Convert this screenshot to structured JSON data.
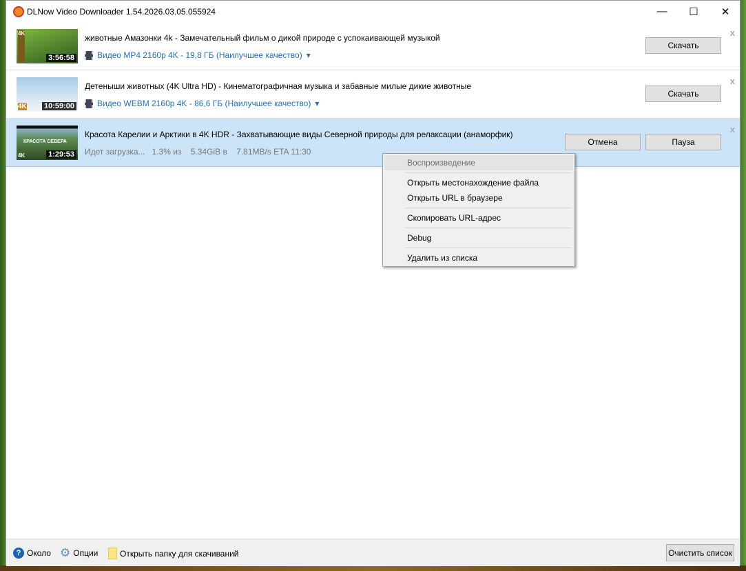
{
  "window": {
    "title": "DLNow Video Downloader 1.54.2026.03.05.055924",
    "minimize": "—",
    "maximize": "☐",
    "close": "✕"
  },
  "items": [
    {
      "title": "животные Амазонки 4k - Замечательный фильм о дикой природе с успокаивающей музыкой",
      "duration": "3:56:58",
      "badge": "4K",
      "format": "Видео MP4 2160p 4K - 19,8 ГБ (Наилучшее качество)",
      "button": "Скачать",
      "remove": "x",
      "thumb_colors": [
        "#6ea83a",
        "#2f5a1a"
      ]
    },
    {
      "title": "Детеныши животных (4K Ultra HD) - Кинематографичная музыка и забавные милые дикие животные",
      "duration": "10:59:00",
      "badge": "4K",
      "format": "Видео WEBM 2160p 4K - 86,6 ГБ (Наилучшее качество)",
      "button": "Скачать",
      "remove": "x",
      "thumb_colors": [
        "#bcd8ee",
        "#f4f6f8"
      ]
    },
    {
      "title": "Красота Карелии и Арктики в 4K HDR - Захватывающие виды Северной природы для релаксации (анаморфик)",
      "duration": "1:29:53",
      "badge": "4K",
      "thumb_text": "КРАСОТА СЕВЕРА",
      "status": "Идет загрузка...   1.3% из    5.34GiB в    7.81MB/s ETA 11:30",
      "cancel": "Отмена",
      "pause": "Пауза",
      "remove": "x",
      "thumb_colors": [
        "#5c8a50",
        "#2c4a24"
      ]
    }
  ],
  "context_menu": [
    "Воспроизведение",
    "Открыть местонахождение файла",
    "Открыть URL в браузере",
    "Скопировать URL-адрес",
    "Debug",
    "Удалить из списка"
  ],
  "footer": {
    "about": "Около",
    "options": "Опции",
    "open_folder": "Открыть папку для скачиваний",
    "clear": "Очистить список"
  },
  "colors": {
    "accent": "#1f6fbf",
    "selected_row": "#cce4f7"
  }
}
